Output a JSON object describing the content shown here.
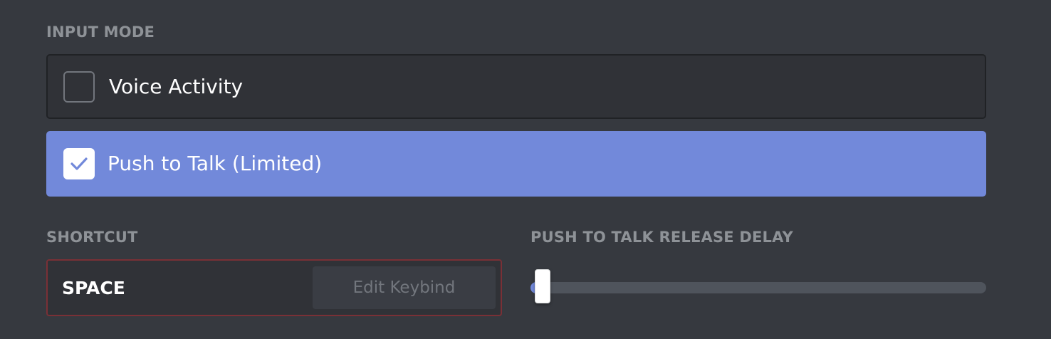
{
  "input_mode": {
    "label": "INPUT MODE",
    "options": [
      {
        "label": "Voice Activity",
        "checked": false
      },
      {
        "label": "Push to Talk (Limited)",
        "checked": true
      }
    ]
  },
  "shortcut": {
    "label": "SHORTCUT",
    "key": "SPACE",
    "edit_label": "Edit Keybind"
  },
  "release_delay": {
    "label": "PUSH TO TALK RELEASE DELAY",
    "value_fraction": 0.0
  },
  "colors": {
    "background": "#36393f",
    "accent": "#7289da",
    "error_border": "#7a3036"
  },
  "icons": {
    "checkmark": "checkmark-icon"
  }
}
